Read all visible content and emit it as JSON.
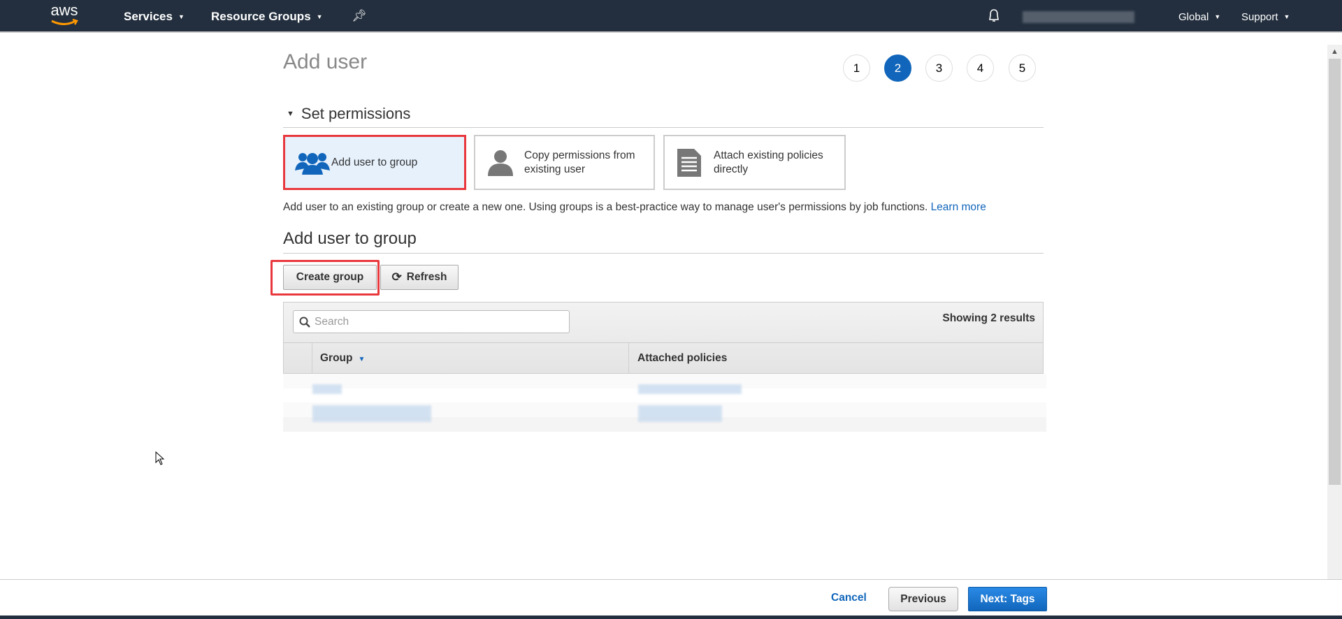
{
  "nav": {
    "logo": "aws",
    "services": "Services",
    "resource_groups": "Resource Groups",
    "region": "Global",
    "support": "Support"
  },
  "page": {
    "title": "Add user",
    "steps": [
      "1",
      "2",
      "3",
      "4",
      "5"
    ],
    "active_step": 2
  },
  "permissions": {
    "section_title": "Set permissions",
    "options": [
      {
        "label": "Add user to group",
        "icon": "users-icon",
        "selected": true
      },
      {
        "label": "Copy permissions from existing user",
        "icon": "user-icon",
        "selected": false
      },
      {
        "label": "Attach existing policies directly",
        "icon": "document-icon",
        "selected": false
      }
    ],
    "description": "Add user to an existing group or create a new one. Using groups is a best-practice way to manage user's permissions by job functions.",
    "learn_more": "Learn more"
  },
  "group": {
    "title": "Add user to group",
    "create_group": "Create group",
    "refresh": "Refresh",
    "search_placeholder": "Search",
    "results": "Showing 2 results",
    "columns": [
      "Group",
      "Attached policies"
    ]
  },
  "footer": {
    "cancel": "Cancel",
    "previous": "Previous",
    "next": "Next: Tags"
  },
  "colors": {
    "accent": "#1166bb",
    "nav_bg": "#232f3e",
    "highlight": "#e8383e"
  }
}
